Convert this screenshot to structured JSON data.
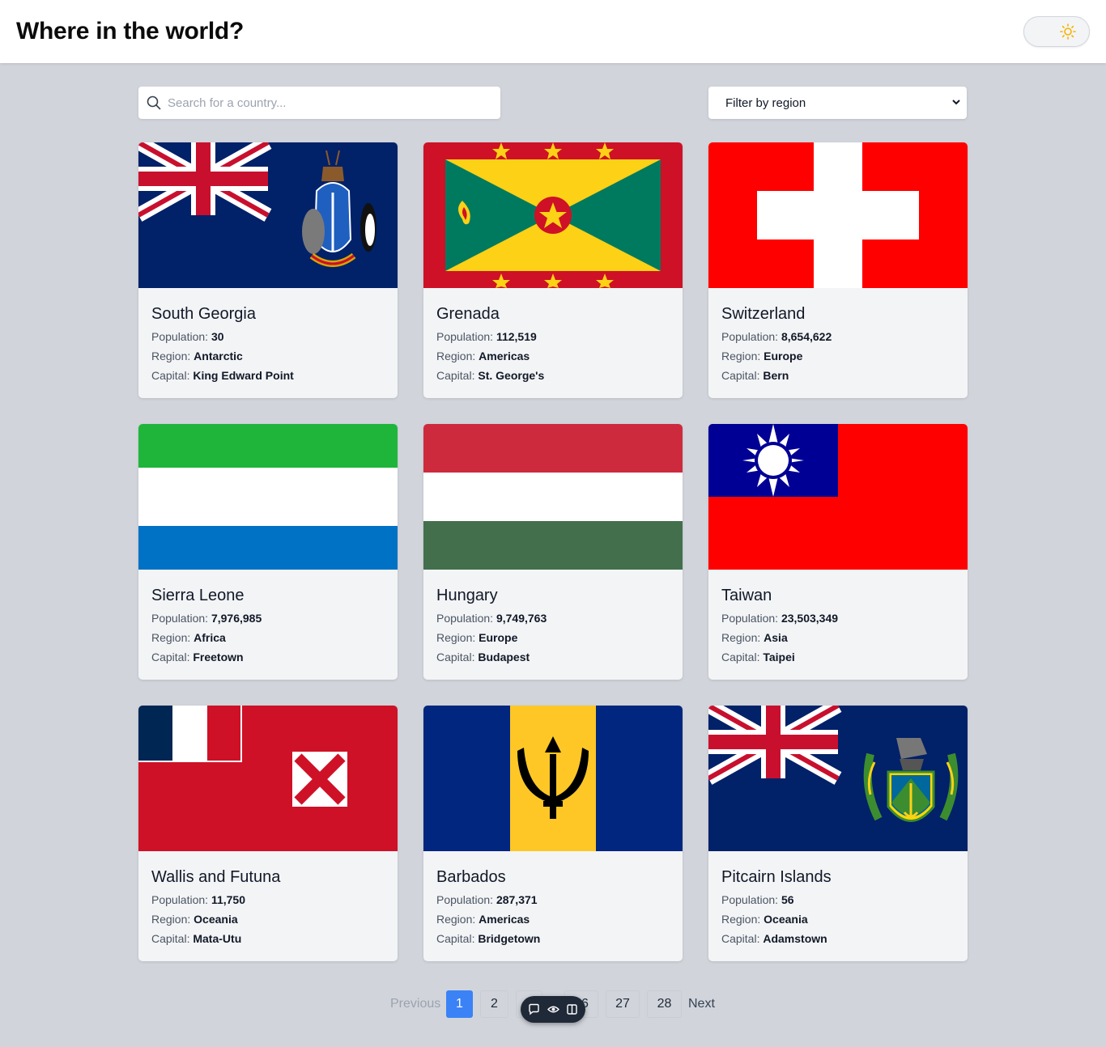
{
  "header": {
    "title": "Where in the world?",
    "theme_icon": "sun-icon"
  },
  "search": {
    "placeholder": "Search for a country...",
    "value": "",
    "icon": "search-icon"
  },
  "filter": {
    "selected": "Filter by region",
    "icon": "chevron-down-icon"
  },
  "labels": {
    "population": "Population:",
    "region": "Region:",
    "capital": "Capital:"
  },
  "countries": [
    {
      "name": "South Georgia",
      "population": "30",
      "region": "Antarctic",
      "capital": "King Edward Point",
      "flag": "south-georgia-flag"
    },
    {
      "name": "Grenada",
      "population": "112,519",
      "region": "Americas",
      "capital": "St. George's",
      "flag": "grenada-flag"
    },
    {
      "name": "Switzerland",
      "population": "8,654,622",
      "region": "Europe",
      "capital": "Bern",
      "flag": "switzerland-flag"
    },
    {
      "name": "Sierra Leone",
      "population": "7,976,985",
      "region": "Africa",
      "capital": "Freetown",
      "flag": "sierra-leone-flag"
    },
    {
      "name": "Hungary",
      "population": "9,749,763",
      "region": "Europe",
      "capital": "Budapest",
      "flag": "hungary-flag"
    },
    {
      "name": "Taiwan",
      "population": "23,503,349",
      "region": "Asia",
      "capital": "Taipei",
      "flag": "taiwan-flag"
    },
    {
      "name": "Wallis and Futuna",
      "population": "11,750",
      "region": "Oceania",
      "capital": "Mata-Utu",
      "flag": "wallis-and-futuna-flag"
    },
    {
      "name": "Barbados",
      "population": "287,371",
      "region": "Americas",
      "capital": "Bridgetown",
      "flag": "barbados-flag"
    },
    {
      "name": "Pitcairn Islands",
      "population": "56",
      "region": "Oceania",
      "capital": "Adamstown",
      "flag": "pitcairn-islands-flag"
    }
  ],
  "pagination": {
    "previous": "Previous",
    "next": "Next",
    "pages": [
      "1",
      "2",
      "3",
      "26",
      "27",
      "28"
    ],
    "current": "1"
  },
  "colors": {
    "page_bg": "#d1d5db",
    "card_bg": "#f3f4f6",
    "accent": "#3b82f6"
  }
}
